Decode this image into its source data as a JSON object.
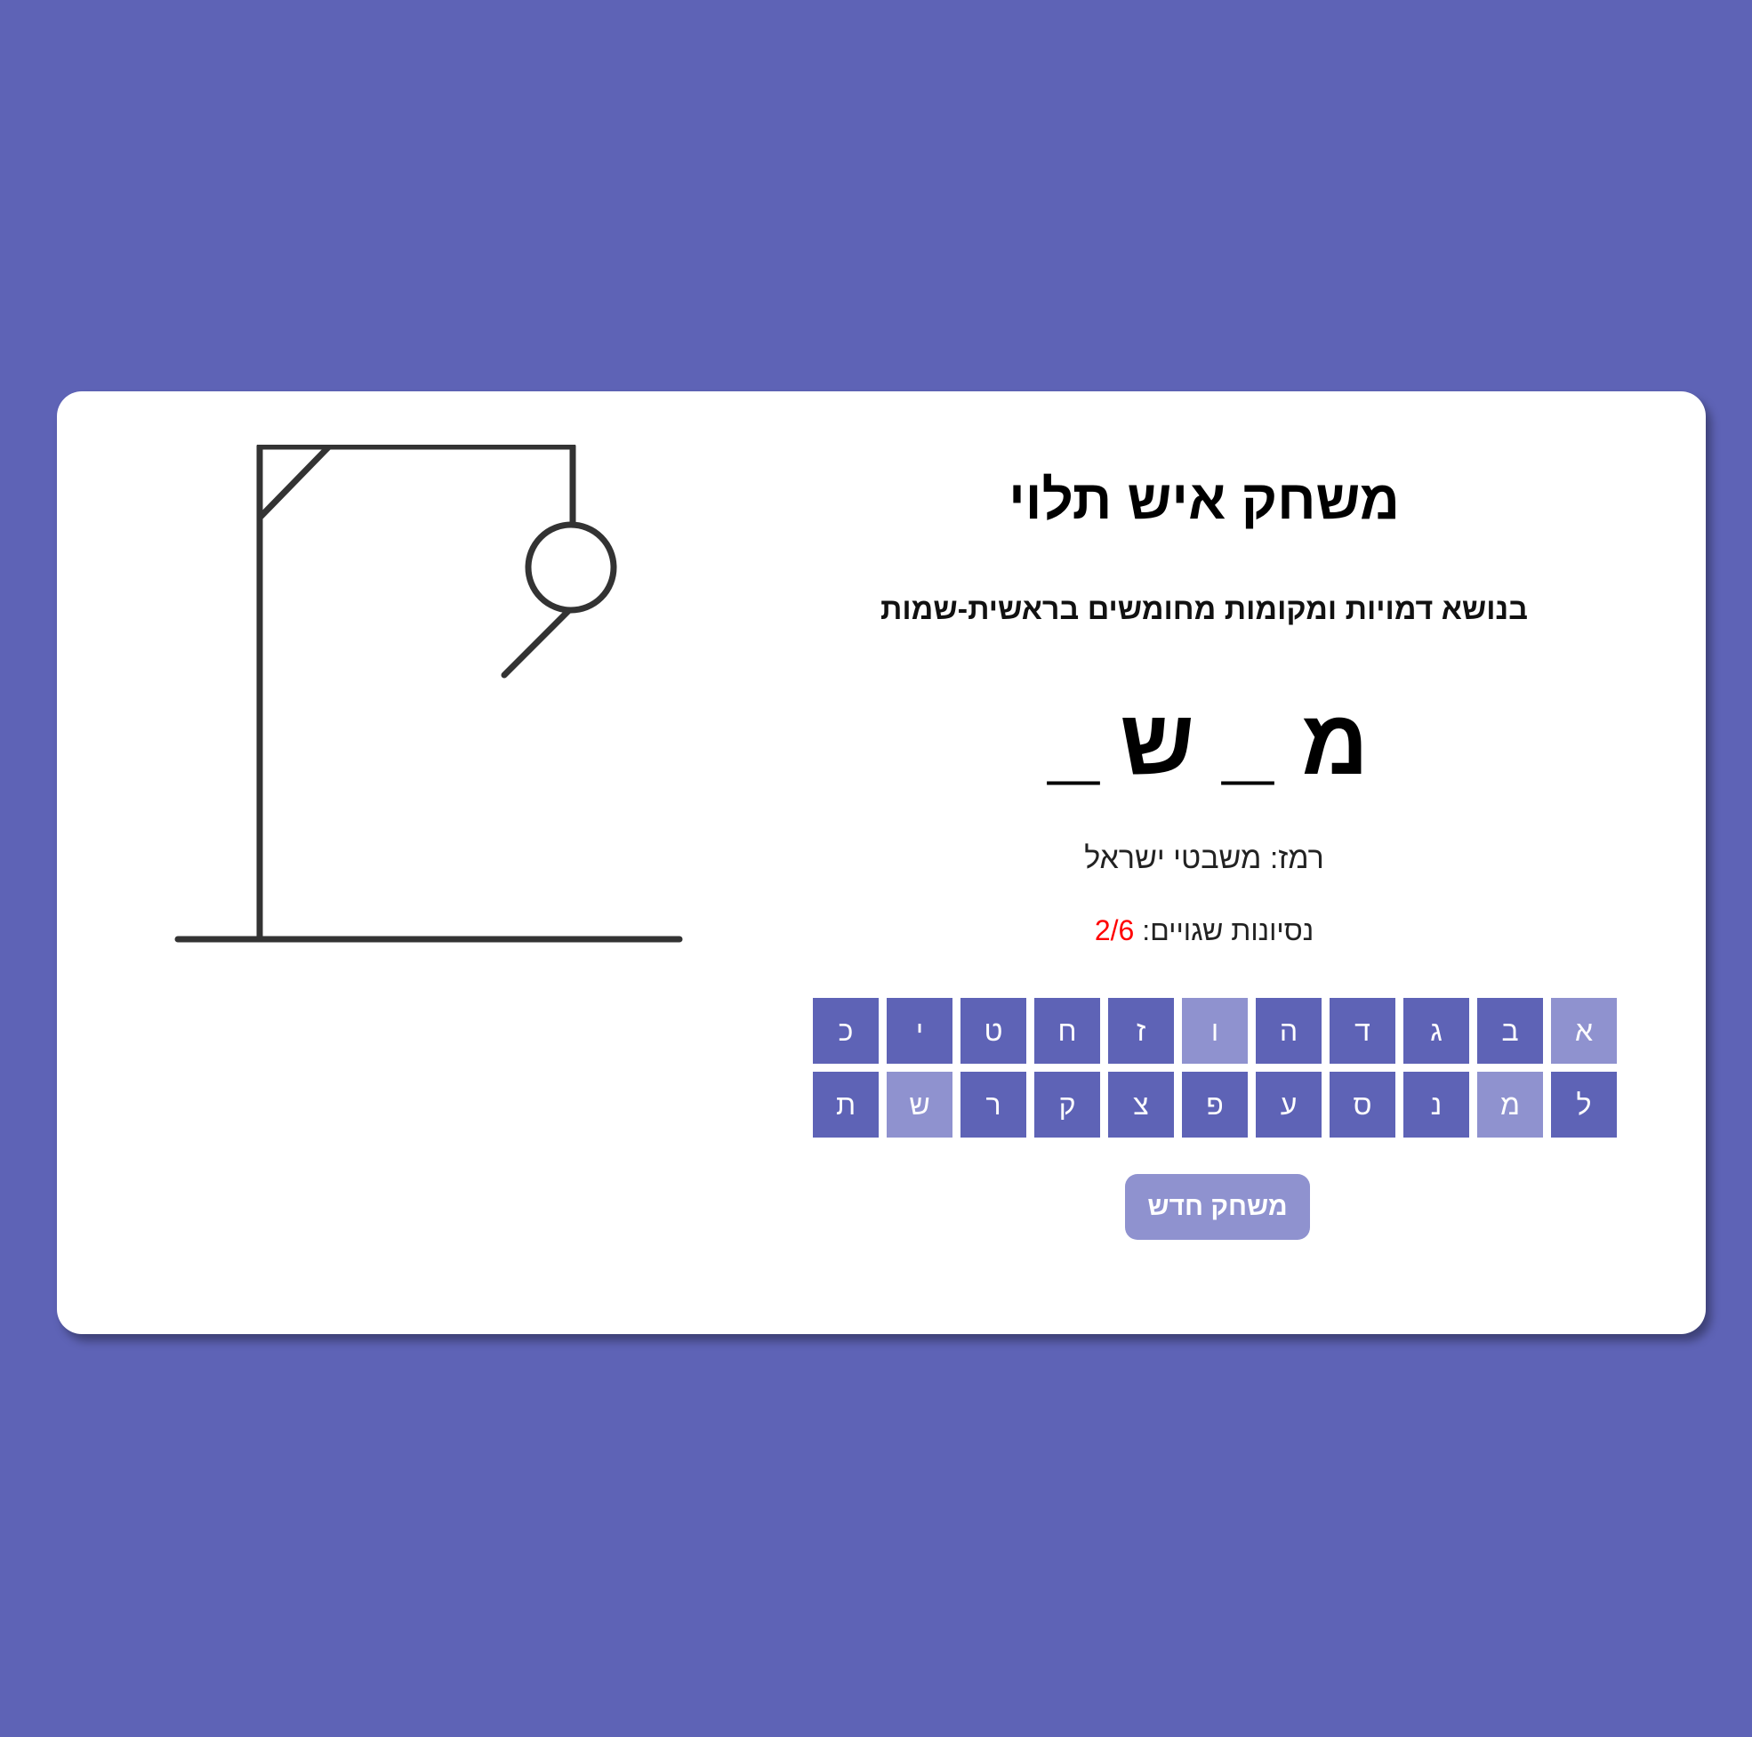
{
  "game": {
    "title": "משחק איש תלוי",
    "subtitle": "בנושא דמויות ומקומות מחומשים בראשית-שמות",
    "word_slots": [
      "מ",
      "_",
      "ש",
      "_"
    ],
    "hint": "רמז: משבטי ישראל",
    "wrong_label": "נסיונות שגויים: ",
    "wrong_count": "2/6",
    "new_game_label": "משחק חדש"
  },
  "keyboard": {
    "keys": [
      {
        "letter": "א",
        "used": true
      },
      {
        "letter": "ב",
        "used": false
      },
      {
        "letter": "ג",
        "used": false
      },
      {
        "letter": "ד",
        "used": false
      },
      {
        "letter": "ה",
        "used": false
      },
      {
        "letter": "ו",
        "used": true
      },
      {
        "letter": "ז",
        "used": false
      },
      {
        "letter": "ח",
        "used": false
      },
      {
        "letter": "ט",
        "used": false
      },
      {
        "letter": "י",
        "used": false
      },
      {
        "letter": "כ",
        "used": false
      },
      {
        "letter": "ל",
        "used": false
      },
      {
        "letter": "מ",
        "used": true
      },
      {
        "letter": "נ",
        "used": false
      },
      {
        "letter": "ס",
        "used": false
      },
      {
        "letter": "ע",
        "used": false
      },
      {
        "letter": "פ",
        "used": false
      },
      {
        "letter": "צ",
        "used": false
      },
      {
        "letter": "ק",
        "used": false
      },
      {
        "letter": "ר",
        "used": false
      },
      {
        "letter": "ש",
        "used": true
      },
      {
        "letter": "ת",
        "used": false
      }
    ]
  },
  "drawing": {
    "parts_shown": [
      "head",
      "right-arm"
    ]
  },
  "colors": {
    "background": "#5e63b6",
    "key": "#5e63b6",
    "key_used": "#8f92cf",
    "wrong_count": "#ff0000"
  }
}
